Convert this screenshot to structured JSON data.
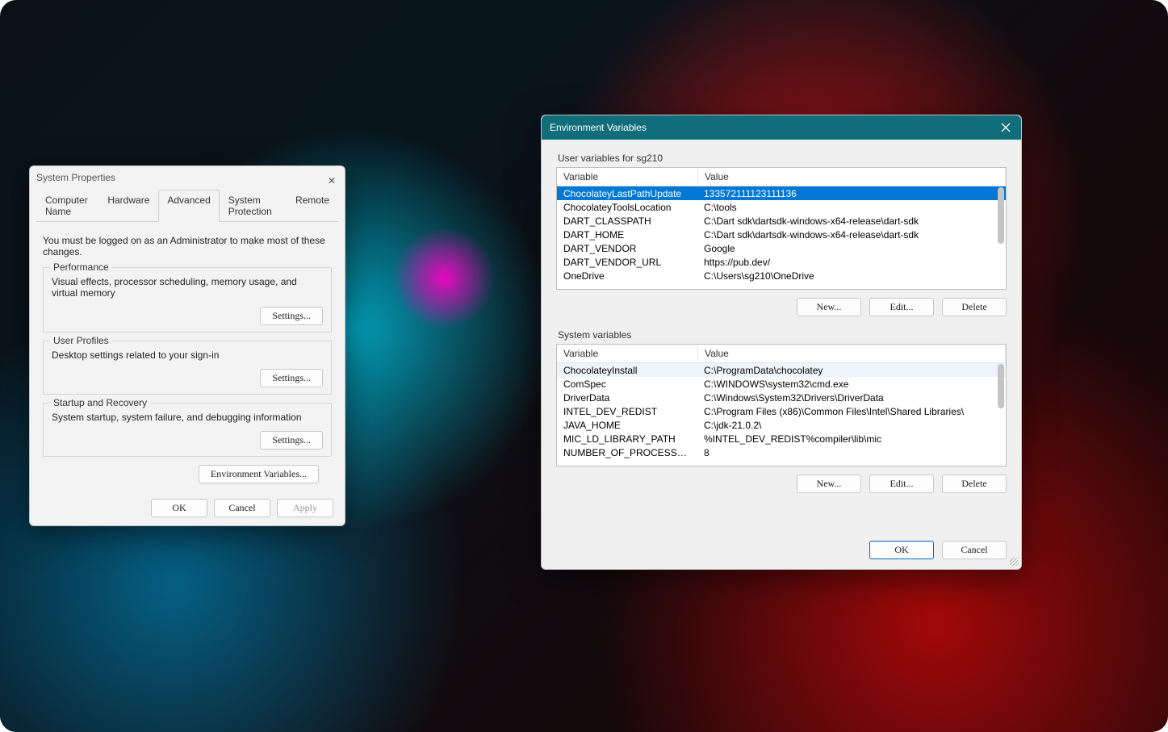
{
  "sysprops": {
    "title": "System Properties",
    "tabs": [
      "Computer Name",
      "Hardware",
      "Advanced",
      "System Protection",
      "Remote"
    ],
    "active_tab": 2,
    "note": "You must be logged on as an Administrator to make most of these changes.",
    "groups": {
      "performance": {
        "legend": "Performance",
        "desc": "Visual effects, processor scheduling, memory usage, and virtual memory",
        "button": "Settings..."
      },
      "profiles": {
        "legend": "User Profiles",
        "desc": "Desktop settings related to your sign-in",
        "button": "Settings..."
      },
      "startup": {
        "legend": "Startup and Recovery",
        "desc": "System startup, system failure, and debugging information",
        "button": "Settings..."
      }
    },
    "envbtn": "Environment Variables...",
    "footer": {
      "ok": "OK",
      "cancel": "Cancel",
      "apply": "Apply"
    }
  },
  "env": {
    "title": "Environment Variables",
    "user_section": "User variables for sg210",
    "sys_section": "System variables",
    "headers": {
      "var": "Variable",
      "val": "Value"
    },
    "user_rows": [
      {
        "var": "ChocolateyLastPathUpdate",
        "val": "133572111123111136",
        "sel": true
      },
      {
        "var": "ChocolateyToolsLocation",
        "val": "C:\\tools"
      },
      {
        "var": "DART_CLASSPATH",
        "val": "C:\\Dart sdk\\dartsdk-windows-x64-release\\dart-sdk"
      },
      {
        "var": "DART_HOME",
        "val": "C:\\Dart sdk\\dartsdk-windows-x64-release\\dart-sdk"
      },
      {
        "var": "DART_VENDOR",
        "val": "Google"
      },
      {
        "var": "DART_VENDOR_URL",
        "val": "https://pub.dev/"
      },
      {
        "var": "OneDrive",
        "val": "C:\\Users\\sg210\\OneDrive"
      }
    ],
    "sys_rows": [
      {
        "var": "ChocolateyInstall",
        "val": "C:\\ProgramData\\chocolatey",
        "hover": true
      },
      {
        "var": "ComSpec",
        "val": "C:\\WINDOWS\\system32\\cmd.exe"
      },
      {
        "var": "DriverData",
        "val": "C:\\Windows\\System32\\Drivers\\DriverData"
      },
      {
        "var": "INTEL_DEV_REDIST",
        "val": "C:\\Program Files (x86)\\Common Files\\Intel\\Shared Libraries\\"
      },
      {
        "var": "JAVA_HOME",
        "val": "C:\\jdk-21.0.2\\"
      },
      {
        "var": "MIC_LD_LIBRARY_PATH",
        "val": "%INTEL_DEV_REDIST%compiler\\lib\\mic"
      },
      {
        "var": "NUMBER_OF_PROCESSORS",
        "val": "8"
      }
    ],
    "buttons": {
      "new": "New...",
      "edit": "Edit...",
      "del": "Delete",
      "ok": "OK",
      "cancel": "Cancel"
    }
  }
}
